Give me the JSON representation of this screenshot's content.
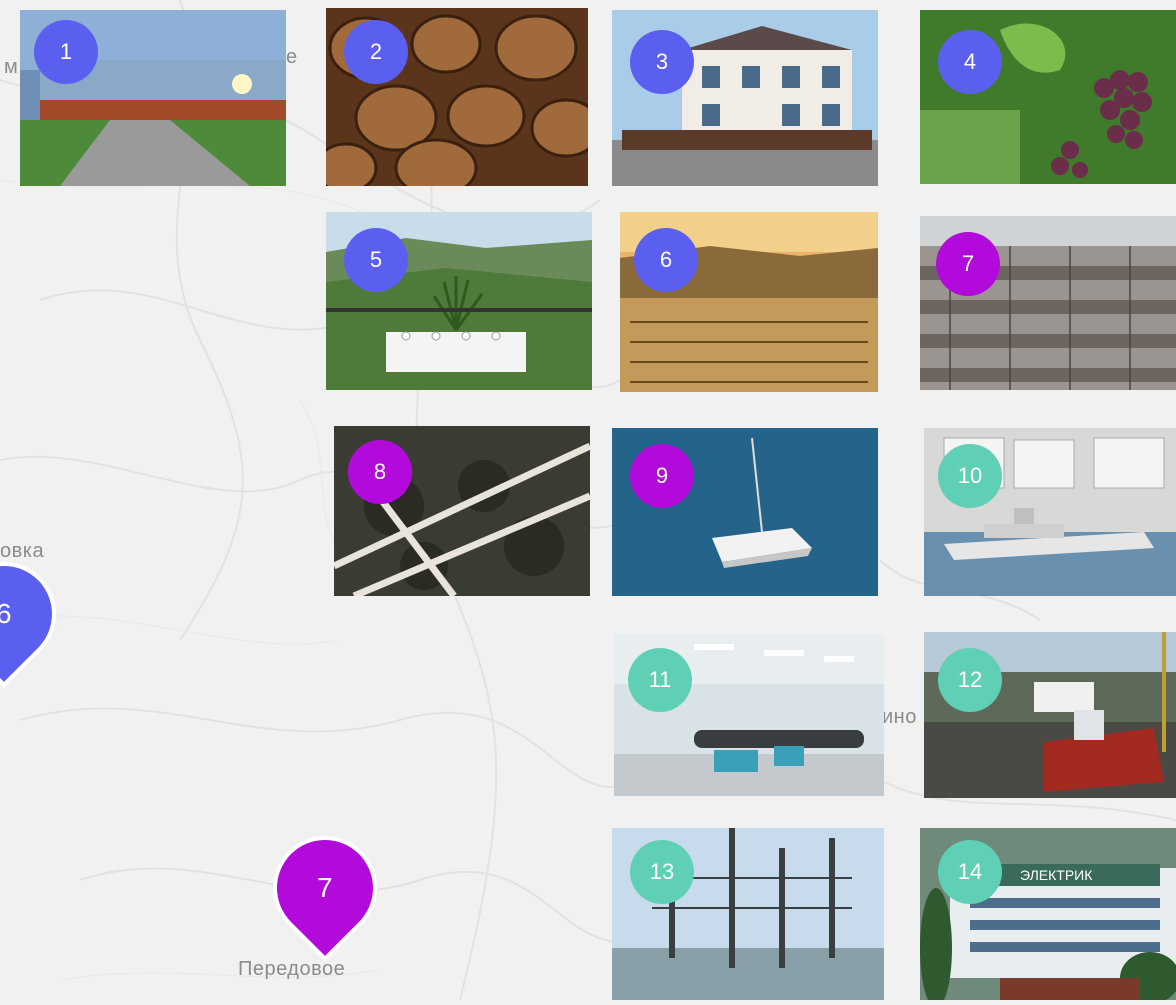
{
  "colors": {
    "blue": "#5b5ff0",
    "purple": "#b10adb",
    "teal": "#5fd0b6"
  },
  "map": {
    "labels": [
      "Передовое",
      "овка",
      "ино",
      "е",
      "м"
    ]
  },
  "map_pins": [
    {
      "number": "6",
      "color": "blue"
    },
    {
      "number": "7",
      "color": "purple"
    }
  ],
  "tiles": [
    {
      "number": "1",
      "color": "blue",
      "subject": "Glass building with paved path"
    },
    {
      "number": "2",
      "color": "blue",
      "subject": "Wine barrels"
    },
    {
      "number": "3",
      "color": "blue",
      "subject": "White mansion winery"
    },
    {
      "number": "4",
      "color": "blue",
      "subject": "Grape cluster on vine"
    },
    {
      "number": "5",
      "color": "blue",
      "subject": "Dining table overlooking hills"
    },
    {
      "number": "6",
      "color": "blue",
      "subject": "Vineyard at sunset"
    },
    {
      "number": "7",
      "color": "purple",
      "subject": "Oyster cages"
    },
    {
      "number": "8",
      "color": "purple",
      "subject": "Mussel farm nets"
    },
    {
      "number": "9",
      "color": "purple",
      "subject": "Catamaran at sea"
    },
    {
      "number": "10",
      "color": "teal",
      "subject": "Ship model museum"
    },
    {
      "number": "11",
      "color": "teal",
      "subject": "Torpedo museum hall"
    },
    {
      "number": "12",
      "color": "teal",
      "subject": "Shipyard dry dock"
    },
    {
      "number": "13",
      "color": "teal",
      "subject": "Power substation"
    },
    {
      "number": "14",
      "color": "teal",
      "subject": "Elektrik factory building"
    }
  ],
  "tile14_sign": "ЭЛЕКТРИК"
}
